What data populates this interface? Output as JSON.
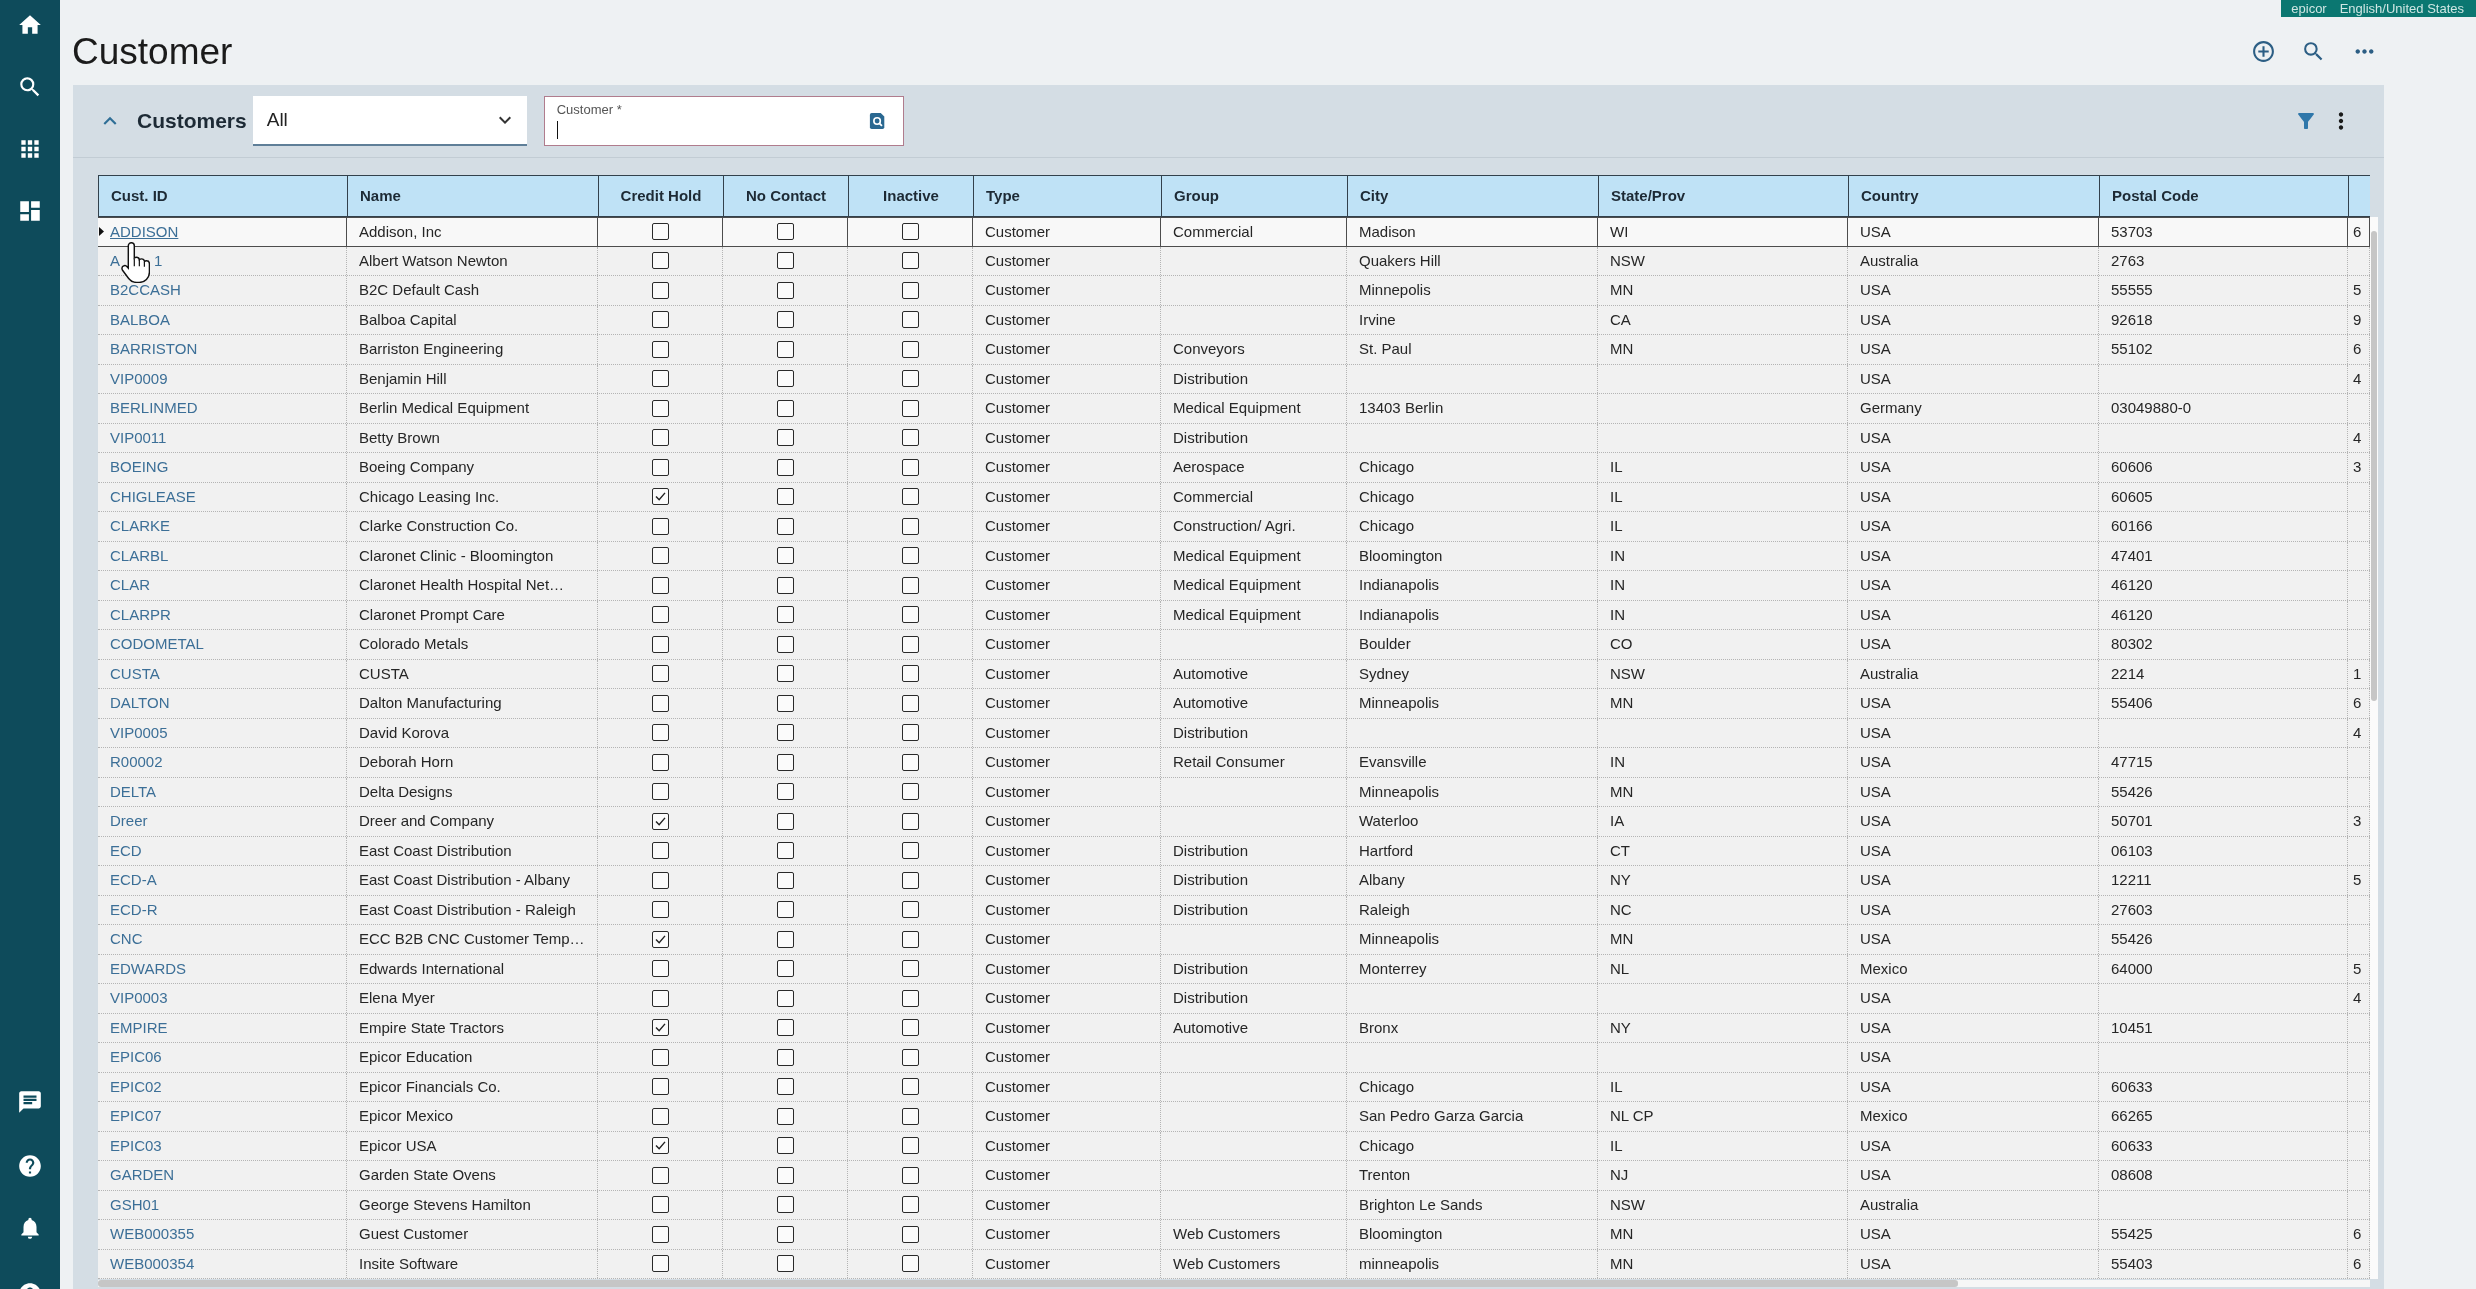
{
  "environment_badge": {
    "company": "epicor",
    "language": "English/United States"
  },
  "page_title": "Customer",
  "panel": {
    "title": "Customers",
    "expanded": true,
    "filter_dropdown": {
      "value": "All"
    },
    "customer_field": {
      "label": "Customer *",
      "focused": true
    }
  },
  "table": {
    "columns": [
      {
        "label": "Cust. ID",
        "kind": "link"
      },
      {
        "label": "Name",
        "kind": "text"
      },
      {
        "label": "Credit Hold",
        "kind": "checkbox"
      },
      {
        "label": "No Contact",
        "kind": "checkbox"
      },
      {
        "label": "Inactive",
        "kind": "checkbox"
      },
      {
        "label": "Type",
        "kind": "text"
      },
      {
        "label": "Group",
        "kind": "text"
      },
      {
        "label": "City",
        "kind": "text"
      },
      {
        "label": "State/Prov",
        "kind": "text"
      },
      {
        "label": "Country",
        "kind": "text"
      },
      {
        "label": "Postal Code",
        "kind": "text"
      },
      {
        "kind": "text"
      }
    ],
    "rows": [
      {
        "selected": true,
        "cust_id": "ADDISON",
        "name": "Addison, Inc",
        "credit_hold": false,
        "no_contact": false,
        "inactive": false,
        "type": "Customer",
        "group": "Commercial",
        "city": "Madison",
        "state_prov": "WI",
        "country": "USA",
        "postal_code": "53703",
        "column_12": "6"
      },
      {
        "selected": false,
        "cust_id": [
          "A",
          "1"
        ],
        "name": "Albert Watson Newton",
        "credit_hold": false,
        "no_contact": false,
        "inactive": false,
        "type": "Customer",
        "city": "Quakers Hill",
        "state_prov": "NSW",
        "country": "Australia",
        "postal_code": "2763"
      },
      {
        "selected": false,
        "cust_id": "B2CCASH",
        "name": "B2C Default Cash",
        "credit_hold": false,
        "no_contact": false,
        "inactive": false,
        "type": "Customer",
        "city": "Minnepolis",
        "state_prov": "MN",
        "country": "USA",
        "postal_code": "55555",
        "column_12": "5"
      },
      {
        "selected": false,
        "cust_id": "BALBOA",
        "name": "Balboa Capital",
        "credit_hold": false,
        "no_contact": false,
        "inactive": false,
        "type": "Customer",
        "city": "Irvine",
        "state_prov": "CA",
        "country": "USA",
        "postal_code": "92618",
        "column_12": "9"
      },
      {
        "selected": false,
        "cust_id": "BARRISTON",
        "name": "Barriston Engineering",
        "credit_hold": false,
        "no_contact": false,
        "inactive": false,
        "type": "Customer",
        "group": "Conveyors",
        "city": "St. Paul",
        "state_prov": "MN",
        "country": "USA",
        "postal_code": "55102",
        "column_12": "6"
      },
      {
        "selected": false,
        "cust_id": "VIP0009",
        "name": "Benjamin Hill",
        "credit_hold": false,
        "no_contact": false,
        "inactive": false,
        "type": "Customer",
        "group": "Distribution",
        "country": "USA",
        "column_12": "4"
      },
      {
        "selected": false,
        "cust_id": "BERLINMED",
        "name": "Berlin Medical Equipment",
        "credit_hold": false,
        "no_contact": false,
        "inactive": false,
        "type": "Customer",
        "group": "Medical Equipment",
        "city": "13403 Berlin",
        "country": "Germany",
        "postal_code": "03049880-0"
      },
      {
        "selected": false,
        "cust_id": "VIP0011",
        "name": "Betty Brown",
        "credit_hold": false,
        "no_contact": false,
        "inactive": false,
        "type": "Customer",
        "group": "Distribution",
        "country": "USA",
        "column_12": "4"
      },
      {
        "selected": false,
        "cust_id": "BOEING",
        "name": "Boeing Company",
        "credit_hold": false,
        "no_contact": false,
        "inactive": false,
        "type": "Customer",
        "group": "Aerospace",
        "city": "Chicago",
        "state_prov": "IL",
        "country": "USA",
        "postal_code": "60606",
        "column_12": "3"
      },
      {
        "selected": false,
        "cust_id": "CHIGLEASE",
        "name": "Chicago Leasing Inc.",
        "credit_hold": true,
        "no_contact": false,
        "inactive": false,
        "type": "Customer",
        "group": "Commercial",
        "city": "Chicago",
        "state_prov": "IL",
        "country": "USA",
        "postal_code": "60605"
      },
      {
        "selected": false,
        "cust_id": "CLARKE",
        "name": "Clarke Construction Co.",
        "credit_hold": false,
        "no_contact": false,
        "inactive": false,
        "type": "Customer",
        "group": "Construction/ Agri.",
        "city": "Chicago",
        "state_prov": "IL",
        "country": "USA",
        "postal_code": "60166"
      },
      {
        "selected": false,
        "cust_id": "CLARBL",
        "name": "Claronet Clinic - Bloomington",
        "credit_hold": false,
        "no_contact": false,
        "inactive": false,
        "type": "Customer",
        "group": "Medical Equipment",
        "city": "Bloomington",
        "state_prov": "IN",
        "country": "USA",
        "postal_code": "47401"
      },
      {
        "selected": false,
        "cust_id": "CLAR",
        "name": "Claronet Health Hospital Net…",
        "credit_hold": false,
        "no_contact": false,
        "inactive": false,
        "type": "Customer",
        "group": "Medical Equipment",
        "city": "Indianapolis",
        "state_prov": "IN",
        "country": "USA",
        "postal_code": "46120"
      },
      {
        "selected": false,
        "cust_id": "CLARPR",
        "name": "Claronet Prompt Care",
        "credit_hold": false,
        "no_contact": false,
        "inactive": false,
        "type": "Customer",
        "group": "Medical Equipment",
        "city": "Indianapolis",
        "state_prov": "IN",
        "country": "USA",
        "postal_code": "46120"
      },
      {
        "selected": false,
        "cust_id": "CODOMETAL",
        "name": "Colorado Metals",
        "credit_hold": false,
        "no_contact": false,
        "inactive": false,
        "type": "Customer",
        "city": "Boulder",
        "state_prov": "CO",
        "country": "USA",
        "postal_code": "80302"
      },
      {
        "selected": false,
        "cust_id": "CUSTA",
        "name": "CUSTA",
        "credit_hold": false,
        "no_contact": false,
        "inactive": false,
        "type": "Customer",
        "group": "Automotive",
        "city": "Sydney",
        "state_prov": "NSW",
        "country": "Australia",
        "postal_code": "2214",
        "column_12": "1"
      },
      {
        "selected": false,
        "cust_id": "DALTON",
        "name": "Dalton Manufacturing",
        "credit_hold": false,
        "no_contact": false,
        "inactive": false,
        "type": "Customer",
        "group": "Automotive",
        "city": "Minneapolis",
        "state_prov": "MN",
        "country": "USA",
        "postal_code": "55406",
        "column_12": "6"
      },
      {
        "selected": false,
        "cust_id": "VIP0005",
        "name": "David Korova",
        "credit_hold": false,
        "no_contact": false,
        "inactive": false,
        "type": "Customer",
        "group": "Distribution",
        "country": "USA",
        "column_12": "4"
      },
      {
        "selected": false,
        "cust_id": "R00002",
        "name": "Deborah Horn",
        "credit_hold": false,
        "no_contact": false,
        "inactive": false,
        "type": "Customer",
        "group": "Retail Consumer",
        "city": "Evansville",
        "state_prov": "IN",
        "country": "USA",
        "postal_code": "47715"
      },
      {
        "selected": false,
        "cust_id": "DELTA",
        "name": "Delta Designs",
        "credit_hold": false,
        "no_contact": false,
        "inactive": false,
        "type": "Customer",
        "city": "Minneapolis",
        "state_prov": "MN",
        "country": "USA",
        "postal_code": "55426"
      },
      {
        "selected": false,
        "cust_id": "Dreer",
        "name": "Dreer and Company",
        "credit_hold": true,
        "no_contact": false,
        "inactive": false,
        "type": "Customer",
        "city": "Waterloo",
        "state_prov": "IA",
        "country": "USA",
        "postal_code": "50701",
        "column_12": "3"
      },
      {
        "selected": false,
        "cust_id": "ECD",
        "name": "East Coast Distribution",
        "credit_hold": false,
        "no_contact": false,
        "inactive": false,
        "type": "Customer",
        "group": "Distribution",
        "city": "Hartford",
        "state_prov": "CT",
        "country": "USA",
        "postal_code": "06103"
      },
      {
        "selected": false,
        "cust_id": "ECD-A",
        "name": "East Coast Distribution - Albany",
        "credit_hold": false,
        "no_contact": false,
        "inactive": false,
        "type": "Customer",
        "group": "Distribution",
        "city": "Albany",
        "state_prov": "NY",
        "country": "USA",
        "postal_code": "12211",
        "column_12": "5"
      },
      {
        "selected": false,
        "cust_id": "ECD-R",
        "name": "East Coast Distribution - Raleigh",
        "credit_hold": false,
        "no_contact": false,
        "inactive": false,
        "type": "Customer",
        "group": "Distribution",
        "city": "Raleigh",
        "state_prov": "NC",
        "country": "USA",
        "postal_code": "27603"
      },
      {
        "selected": false,
        "cust_id": "CNC",
        "name": "ECC B2B CNC Customer Temp…",
        "credit_hold": true,
        "no_contact": false,
        "inactive": false,
        "type": "Customer",
        "city": "Minneapolis",
        "state_prov": "MN",
        "country": "USA",
        "postal_code": "55426"
      },
      {
        "selected": false,
        "cust_id": "EDWARDS",
        "name": "Edwards International",
        "credit_hold": false,
        "no_contact": false,
        "inactive": false,
        "type": "Customer",
        "group": "Distribution",
        "city": "Monterrey",
        "state_prov": "NL",
        "country": "Mexico",
        "postal_code": "64000",
        "column_12": "5"
      },
      {
        "selected": false,
        "cust_id": "VIP0003",
        "name": "Elena Myer",
        "credit_hold": false,
        "no_contact": false,
        "inactive": false,
        "type": "Customer",
        "group": "Distribution",
        "country": "USA",
        "column_12": "4"
      },
      {
        "selected": false,
        "cust_id": "EMPIRE",
        "name": "Empire State Tractors",
        "credit_hold": true,
        "no_contact": false,
        "inactive": false,
        "type": "Customer",
        "group": "Automotive",
        "city": "Bronx",
        "state_prov": "NY",
        "country": "USA",
        "postal_code": "10451"
      },
      {
        "selected": false,
        "cust_id": "EPIC06",
        "name": "Epicor Education",
        "credit_hold": false,
        "no_contact": false,
        "inactive": false,
        "type": "Customer",
        "country": "USA"
      },
      {
        "selected": false,
        "cust_id": "EPIC02",
        "name": "Epicor Financials Co.",
        "credit_hold": false,
        "no_contact": false,
        "inactive": false,
        "type": "Customer",
        "city": "Chicago",
        "state_prov": "IL",
        "country": "USA",
        "postal_code": "60633"
      },
      {
        "selected": false,
        "cust_id": "EPIC07",
        "name": "Epicor Mexico",
        "credit_hold": false,
        "no_contact": false,
        "inactive": false,
        "type": "Customer",
        "city": "San Pedro Garza Garcia",
        "state_prov": "NL CP",
        "country": "Mexico",
        "postal_code": "66265"
      },
      {
        "selected": false,
        "cust_id": "EPIC03",
        "name": "Epicor USA",
        "credit_hold": true,
        "no_contact": false,
        "inactive": false,
        "type": "Customer",
        "city": "Chicago",
        "state_prov": "IL",
        "country": "USA",
        "postal_code": "60633"
      },
      {
        "selected": false,
        "cust_id": "GARDEN",
        "name": "Garden State Ovens",
        "credit_hold": false,
        "no_contact": false,
        "inactive": false,
        "type": "Customer",
        "city": "Trenton",
        "state_prov": "NJ",
        "country": "USA",
        "postal_code": "08608"
      },
      {
        "selected": false,
        "cust_id": "GSH01",
        "name": "George Stevens Hamilton",
        "credit_hold": false,
        "no_contact": false,
        "inactive": false,
        "type": "Customer",
        "city": "Brighton Le Sands",
        "state_prov": "NSW",
        "country": "Australia"
      },
      {
        "selected": false,
        "cust_id": "WEB000355",
        "name": "Guest Customer",
        "credit_hold": false,
        "no_contact": false,
        "inactive": false,
        "type": "Customer",
        "group": "Web Customers",
        "city": "Bloomington",
        "state_prov": "MN",
        "country": "USA",
        "postal_code": "55425",
        "column_12": "6"
      },
      {
        "selected": false,
        "cust_id": "WEB000354",
        "name": "Insite Software",
        "credit_hold": false,
        "no_contact": false,
        "inactive": false,
        "type": "Customer",
        "group": "Web Customers",
        "city": "minneapolis",
        "state_prov": "MN",
        "country": "USA",
        "postal_code": "55403",
        "column_12": "6"
      }
    ]
  }
}
